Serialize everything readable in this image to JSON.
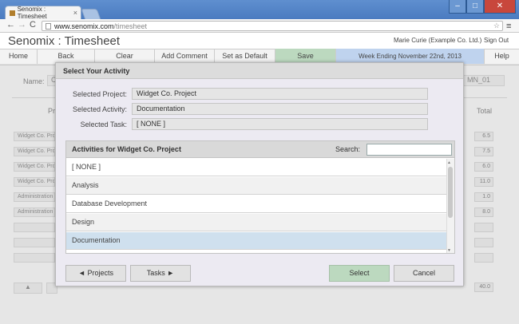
{
  "browser": {
    "tab_title": "Senomix : Timesheet",
    "tab_close": "×",
    "url_host": "www.senomix.com",
    "url_path": "/timesheet",
    "star": "☆",
    "menu": "≡",
    "nav_back": "←",
    "nav_forward": "→",
    "nav_reload": "C",
    "win_min": "–",
    "win_max": "□",
    "win_close": "✕"
  },
  "app": {
    "title": "Senomix : Timesheet",
    "user": "Marie Curie  (Example Co. Ltd.)",
    "sign_out": "Sign Out"
  },
  "nav": {
    "home": "Home",
    "back": "Back",
    "clear": "Clear",
    "add_comment": "Add Comment",
    "set_default": "Set as Default",
    "save": "Save",
    "week_ending": "Week Ending November 22nd, 2013",
    "help": "Help"
  },
  "background": {
    "name_label": "Name:",
    "name_value": "C",
    "code_value": "MN_01",
    "col_label": "Pr",
    "total_label": "Total",
    "rows": [
      "Widget Co. Pro",
      "Widget Co. Pro",
      "Widget Co. Pro",
      "Widget Co. Pro",
      "Administration",
      "Administration"
    ],
    "totals": [
      "6.5",
      "7.5",
      "6.0",
      "11.0",
      "1.0",
      "8.0"
    ],
    "grand_total": "40.0",
    "up_arrow": "▲"
  },
  "modal": {
    "title": "Select Your Activity",
    "fields": {
      "project_label": "Selected Project:",
      "project_value": "Widget Co. Project",
      "activity_label": "Selected Activity:",
      "activity_value": "Documentation",
      "task_label": "Selected Task:",
      "task_value": "[ NONE ]"
    },
    "list": {
      "header": "Activities for Widget Co. Project",
      "search_label": "Search:",
      "search_value": "",
      "items": [
        "[ NONE ]",
        "Analysis",
        "Database Development",
        "Design",
        "Documentation"
      ],
      "selected": "Documentation"
    },
    "buttons": {
      "projects": "◄ Projects",
      "tasks": "Tasks ►",
      "select": "Select",
      "cancel": "Cancel"
    }
  }
}
